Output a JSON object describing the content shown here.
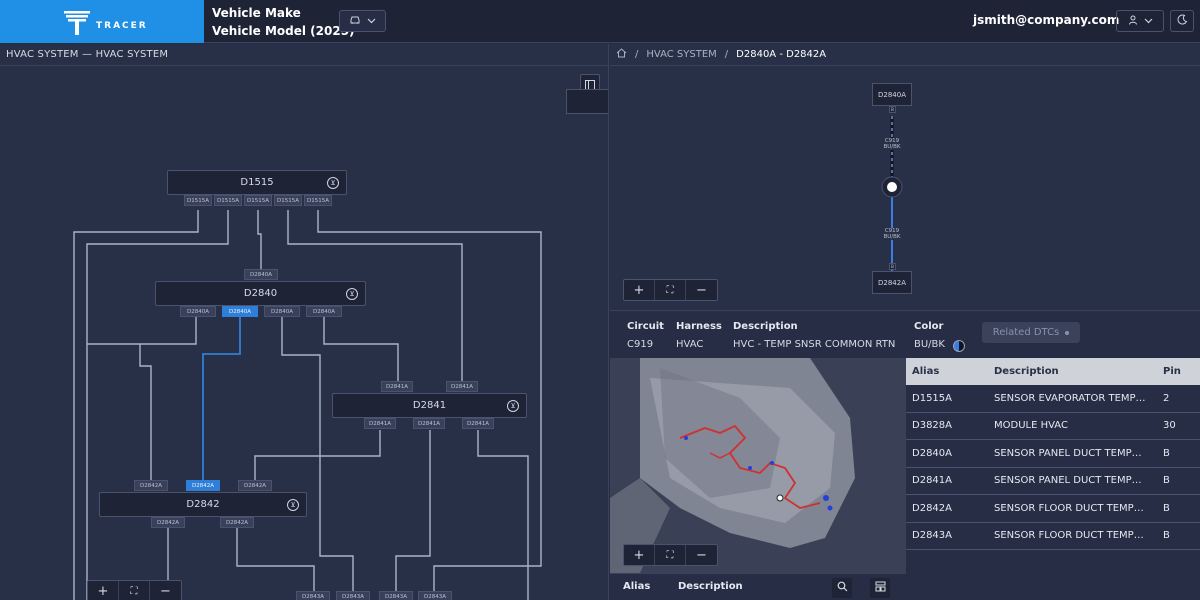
{
  "brand": {
    "name": "TRACER"
  },
  "vehicle": {
    "make": "Vehicle Make",
    "model": "Vehicle Model (2025)"
  },
  "user": {
    "email": "jsmith@company.com"
  },
  "left_pane": {
    "title": "HVAC SYSTEM — HVAC SYSTEM",
    "nodes": {
      "d1515": {
        "label": "D1515",
        "pins": [
          "D1515A",
          "D1515A",
          "D1515A",
          "D1515A",
          "D1515A"
        ]
      },
      "d2840": {
        "label": "D2840",
        "top_pin": "D2840A",
        "pins": [
          "D2840A",
          "D2840A",
          "D2840A",
          "D2840A"
        ]
      },
      "d2841": {
        "label": "D2841",
        "top_pins": [
          "D2841A",
          "D2841A"
        ],
        "pins": [
          "D2841A",
          "D2841A",
          "D2841A"
        ]
      },
      "d2842": {
        "label": "D2842",
        "top_pins": [
          "D2842A",
          "D2842A",
          "D2842A"
        ],
        "pins": [
          "D2842A",
          "D2842A"
        ]
      },
      "d2843": {
        "pins": [
          "D2843A",
          "D2843A",
          "D2843A",
          "D2843A"
        ]
      }
    }
  },
  "right_pane": {
    "breadcrumb": {
      "root": "HVAC SYSTEM",
      "current": "D2840A - D2842A"
    },
    "circuit_view": {
      "top_node": "D2840A",
      "bottom_node": "D2842A",
      "pin_label": "B",
      "wire_label_line1": "C919",
      "wire_label_line2": "BU/BK"
    },
    "circuit_info": {
      "headers": {
        "circuit": "Circuit",
        "harness": "Harness",
        "description": "Description",
        "color": "Color"
      },
      "values": {
        "circuit": "C919",
        "harness": "HVAC",
        "description": "HVC - TEMP SNSR COMMON RTN",
        "color": "BU/BK"
      },
      "related_dtcs_label": "Related DTCs"
    },
    "alias_table": {
      "headers": {
        "alias": "Alias",
        "description": "Description",
        "pin": "Pin"
      },
      "rows": [
        {
          "alias": "D1515A",
          "description": "SENSOR EVAPORATOR TEMP…",
          "pin": "2"
        },
        {
          "alias": "D3828A",
          "description": "MODULE HVAC",
          "pin": "30"
        },
        {
          "alias": "D2840A",
          "description": "SENSOR PANEL DUCT TEMP…",
          "pin": "B"
        },
        {
          "alias": "D2841A",
          "description": "SENSOR PANEL DUCT TEMP…",
          "pin": "B"
        },
        {
          "alias": "D2842A",
          "description": "SENSOR FLOOR DUCT TEMP…",
          "pin": "B"
        },
        {
          "alias": "D2843A",
          "description": "SENSOR FLOOR DUCT TEMP…",
          "pin": "B"
        }
      ]
    },
    "bottom_bar": {
      "alias": "Alias",
      "description": "Description"
    }
  },
  "colors": {
    "accent": "#1f90e6",
    "active_wire": "#2f7fd8",
    "background": "#262d44"
  },
  "icons": [
    "car-icon",
    "chevron-down-icon",
    "user-icon",
    "moon-icon",
    "home-icon",
    "panel-toggle-icon",
    "node-icon",
    "plus-icon",
    "fit-icon",
    "minus-icon",
    "search-icon",
    "filter-icon"
  ]
}
